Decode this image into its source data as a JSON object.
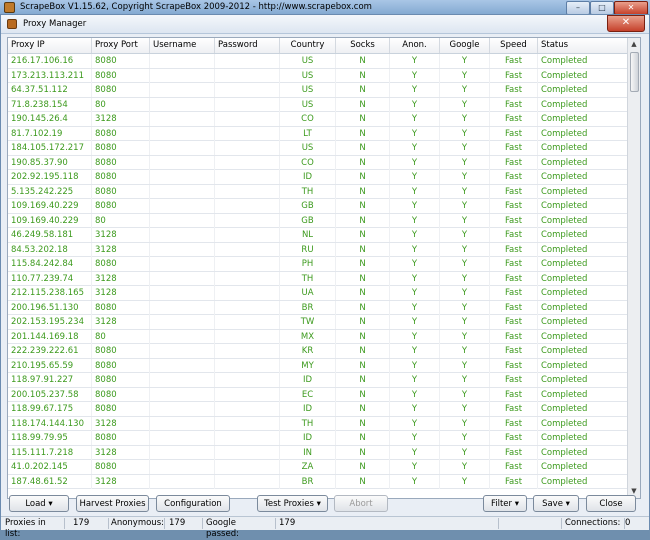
{
  "app": {
    "title": "ScrapeBox V1.15.62, Copyright ScrapeBox 2009-2012 - http://www.scrapebox.com",
    "minimize": "–",
    "maximize": "□",
    "close": "✕"
  },
  "window": {
    "title": "Proxy Manager",
    "close": "✕"
  },
  "columns": [
    "Proxy IP",
    "Proxy Port",
    "Username",
    "Password",
    "Country",
    "Socks",
    "Anon.",
    "Google",
    "Speed",
    "Status"
  ],
  "rows": [
    [
      "216.17.106.16",
      "8080",
      "",
      "",
      "US",
      "N",
      "Y",
      "Y",
      "Fast",
      "Completed"
    ],
    [
      "173.213.113.211",
      "8080",
      "",
      "",
      "US",
      "N",
      "Y",
      "Y",
      "Fast",
      "Completed"
    ],
    [
      "64.37.51.112",
      "8080",
      "",
      "",
      "US",
      "N",
      "Y",
      "Y",
      "Fast",
      "Completed"
    ],
    [
      "71.8.238.154",
      "80",
      "",
      "",
      "US",
      "N",
      "Y",
      "Y",
      "Fast",
      "Completed"
    ],
    [
      "190.145.26.4",
      "3128",
      "",
      "",
      "CO",
      "N",
      "Y",
      "Y",
      "Fast",
      "Completed"
    ],
    [
      "81.7.102.19",
      "8080",
      "",
      "",
      "LT",
      "N",
      "Y",
      "Y",
      "Fast",
      "Completed"
    ],
    [
      "184.105.172.217",
      "8080",
      "",
      "",
      "US",
      "N",
      "Y",
      "Y",
      "Fast",
      "Completed"
    ],
    [
      "190.85.37.90",
      "8080",
      "",
      "",
      "CO",
      "N",
      "Y",
      "Y",
      "Fast",
      "Completed"
    ],
    [
      "202.92.195.118",
      "8080",
      "",
      "",
      "ID",
      "N",
      "Y",
      "Y",
      "Fast",
      "Completed"
    ],
    [
      "5.135.242.225",
      "8080",
      "",
      "",
      "TH",
      "N",
      "Y",
      "Y",
      "Fast",
      "Completed"
    ],
    [
      "109.169.40.229",
      "8080",
      "",
      "",
      "GB",
      "N",
      "Y",
      "Y",
      "Fast",
      "Completed"
    ],
    [
      "109.169.40.229",
      "80",
      "",
      "",
      "GB",
      "N",
      "Y",
      "Y",
      "Fast",
      "Completed"
    ],
    [
      "46.249.58.181",
      "3128",
      "",
      "",
      "NL",
      "N",
      "Y",
      "Y",
      "Fast",
      "Completed"
    ],
    [
      "84.53.202.18",
      "3128",
      "",
      "",
      "RU",
      "N",
      "Y",
      "Y",
      "Fast",
      "Completed"
    ],
    [
      "115.84.242.84",
      "8080",
      "",
      "",
      "PH",
      "N",
      "Y",
      "Y",
      "Fast",
      "Completed"
    ],
    [
      "110.77.239.74",
      "3128",
      "",
      "",
      "TH",
      "N",
      "Y",
      "Y",
      "Fast",
      "Completed"
    ],
    [
      "212.115.238.165",
      "3128",
      "",
      "",
      "UA",
      "N",
      "Y",
      "Y",
      "Fast",
      "Completed"
    ],
    [
      "200.196.51.130",
      "8080",
      "",
      "",
      "BR",
      "N",
      "Y",
      "Y",
      "Fast",
      "Completed"
    ],
    [
      "202.153.195.234",
      "3128",
      "",
      "",
      "TW",
      "N",
      "Y",
      "Y",
      "Fast",
      "Completed"
    ],
    [
      "201.144.169.18",
      "80",
      "",
      "",
      "MX",
      "N",
      "Y",
      "Y",
      "Fast",
      "Completed"
    ],
    [
      "222.239.222.61",
      "8080",
      "",
      "",
      "KR",
      "N",
      "Y",
      "Y",
      "Fast",
      "Completed"
    ],
    [
      "210.195.65.59",
      "8080",
      "",
      "",
      "MY",
      "N",
      "Y",
      "Y",
      "Fast",
      "Completed"
    ],
    [
      "118.97.91.227",
      "8080",
      "",
      "",
      "ID",
      "N",
      "Y",
      "Y",
      "Fast",
      "Completed"
    ],
    [
      "200.105.237.58",
      "8080",
      "",
      "",
      "EC",
      "N",
      "Y",
      "Y",
      "Fast",
      "Completed"
    ],
    [
      "118.99.67.175",
      "8080",
      "",
      "",
      "ID",
      "N",
      "Y",
      "Y",
      "Fast",
      "Completed"
    ],
    [
      "118.174.144.130",
      "3128",
      "",
      "",
      "TH",
      "N",
      "Y",
      "Y",
      "Fast",
      "Completed"
    ],
    [
      "118.99.79.95",
      "8080",
      "",
      "",
      "ID",
      "N",
      "Y",
      "Y",
      "Fast",
      "Completed"
    ],
    [
      "115.111.7.218",
      "3128",
      "",
      "",
      "IN",
      "N",
      "Y",
      "Y",
      "Fast",
      "Completed"
    ],
    [
      "41.0.202.145",
      "8080",
      "",
      "",
      "ZA",
      "N",
      "Y",
      "Y",
      "Fast",
      "Completed"
    ],
    [
      "187.48.61.52",
      "3128",
      "",
      "",
      "BR",
      "N",
      "Y",
      "Y",
      "Fast",
      "Completed"
    ]
  ],
  "buttons": {
    "load": "Load ▾",
    "harvest": "Harvest Proxies",
    "configuration": "Configuration",
    "test": "Test Proxies ▾",
    "abort": "Abort",
    "filter": "Filter ▾",
    "save": "Save ▾",
    "close": "Close"
  },
  "status": {
    "proxies_label": "Proxies in list:",
    "proxies_count": "179",
    "anon_label": "Anonymous:",
    "anon_count": "179",
    "google_label": "Google passed:",
    "google_count": "179",
    "connections_label": "Connections:",
    "connections_count": "0"
  },
  "colors": {
    "row_text": "#3c9a1d",
    "title_close": "#c5412b"
  }
}
